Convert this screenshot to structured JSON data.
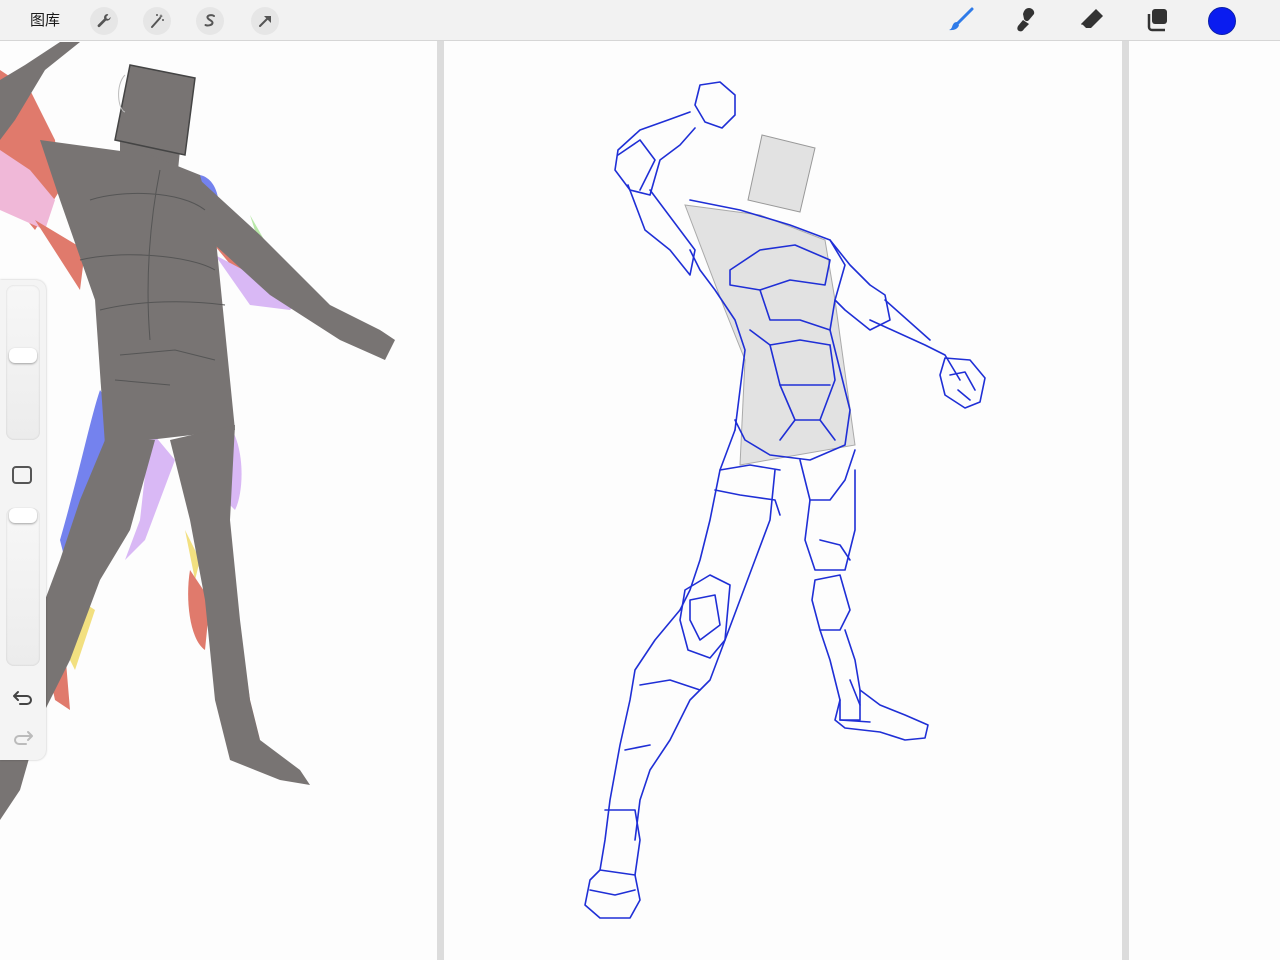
{
  "toolbar": {
    "gallery_label": "图库",
    "left_tools": [
      {
        "icon": "wrench-icon",
        "name": "actions"
      },
      {
        "icon": "magic-wand-icon",
        "name": "adjustments"
      },
      {
        "icon": "selection-s-icon",
        "name": "selection"
      },
      {
        "icon": "transform-arrow-icon",
        "name": "transform"
      }
    ],
    "right_tools": [
      {
        "icon": "brush-icon",
        "active": true
      },
      {
        "icon": "smudge-icon"
      },
      {
        "icon": "eraser-icon"
      },
      {
        "icon": "layers-icon"
      }
    ],
    "current_color": "#0a1cf0",
    "active_tool_color": "#2f7be8"
  },
  "sidebar": {
    "brush_size_level": 0.55,
    "opacity_level": 1.0,
    "modify_button_icon": "square-icon",
    "undo_icon": "undo-icon",
    "redo_icon": "redo-icon"
  },
  "canvas": {
    "sketch_stroke_color": "#1f2fd6",
    "mannequin_fill": "#787473"
  }
}
